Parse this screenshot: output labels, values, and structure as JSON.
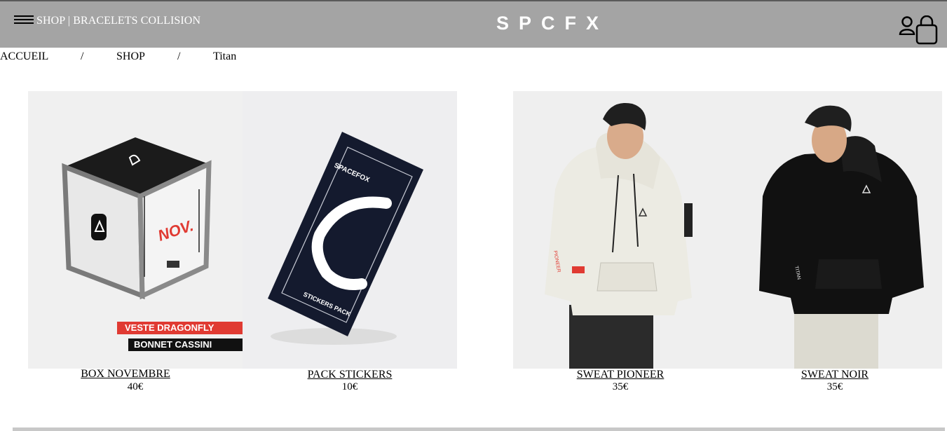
{
  "header": {
    "title": "SHOP | BRACELETS COLLISION",
    "logo": "SPCFX",
    "icons": [
      "menu-icon",
      "user-icon",
      "bag-icon"
    ]
  },
  "breadcrumb": {
    "items": [
      "ACCUEIL",
      "SHOP",
      "Titan"
    ],
    "separator": "/"
  },
  "products": [
    {
      "name": "BOX NOVEMBRE",
      "price": "40€",
      "labels": [
        "NOV.",
        "VESTE DRAGONFLY",
        "BONNET CASSINI"
      ]
    },
    {
      "name": "PACK STICKERS",
      "price": "10€",
      "labels": [
        "SPACEFOX",
        "STICKERS PACK"
      ]
    },
    {
      "name": "SWEAT PIONEER",
      "price": "35€",
      "labels": [
        "PIONEER"
      ]
    },
    {
      "name": "SWEAT NOIR",
      "price": "35€",
      "labels": [
        "TITAN"
      ]
    }
  ],
  "colors": {
    "header_bg": "#a4a4a4",
    "accent_red": "#e03a32",
    "dark": "#111111"
  }
}
